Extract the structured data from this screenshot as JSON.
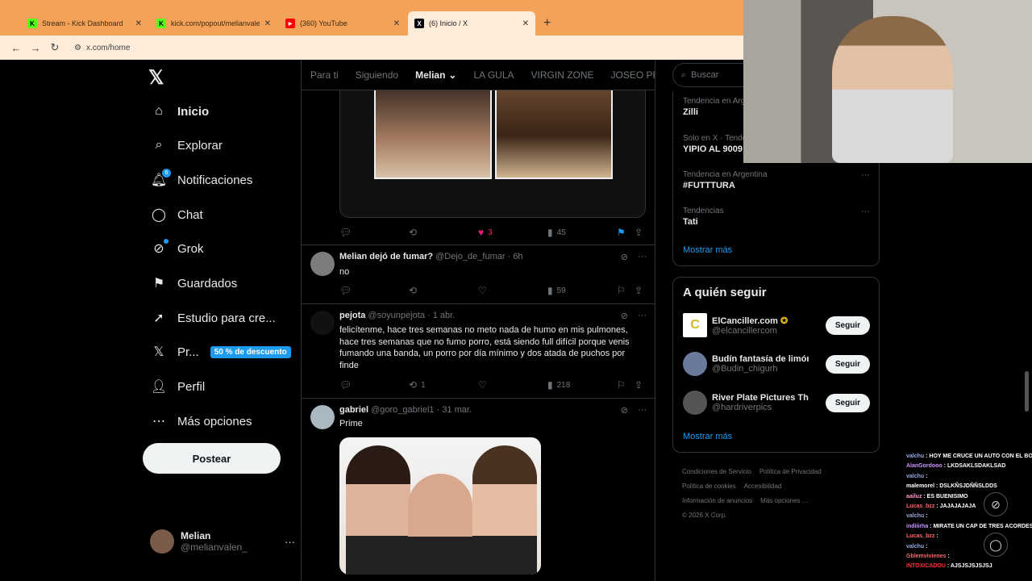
{
  "browser": {
    "tabs": [
      {
        "title": "Stream - Kick Dashboard",
        "favicon": "K",
        "color": "#53fc18"
      },
      {
        "title": "kick.com/popout/melianvalen/...",
        "favicon": "K",
        "color": "#53fc18"
      },
      {
        "title": "(360) YouTube",
        "favicon": "▶",
        "color": "#ff0000"
      },
      {
        "title": "(6) Inicio / X",
        "favicon": "X",
        "color": "#000000"
      }
    ],
    "url": "x.com/home"
  },
  "sidebar": {
    "items": [
      {
        "label": "Inicio",
        "icon": "home-icon"
      },
      {
        "label": "Explorar",
        "icon": "search-icon"
      },
      {
        "label": "Notificaciones",
        "icon": "bell-icon",
        "badge": "6"
      },
      {
        "label": "Chat",
        "icon": "chat-icon"
      },
      {
        "label": "Grok",
        "icon": "grok-icon"
      },
      {
        "label": "Guardados",
        "icon": "bookmark-icon"
      },
      {
        "label": "Estudio para cre...",
        "icon": "rocket-icon"
      },
      {
        "label": "Pr...",
        "icon": "x-icon",
        "promo": "50 % de descuento"
      },
      {
        "label": "Perfil",
        "icon": "person-icon"
      },
      {
        "label": "Más opciones",
        "icon": "more-circle-icon"
      }
    ],
    "post_label": "Postear",
    "account": {
      "name": "Melian",
      "handle": "@melianvalen_"
    }
  },
  "feed": {
    "tabs": [
      "Para ti",
      "Siguiendo",
      "Melian",
      "LA GULA",
      "VIRGIN ZONE",
      "JOSEO PRI"
    ],
    "active_tab": "Melian",
    "posts": [
      {
        "replies": "",
        "reposts": "",
        "likes": "3",
        "views": "45",
        "liked": true,
        "bookmarked": true
      },
      {
        "name": "Melian dejó de fumar?",
        "handle": "@Dejo_de_fumar",
        "time": "6h",
        "text": "no",
        "replies": "",
        "reposts": "",
        "likes": "",
        "views": "59"
      },
      {
        "name": "pejota",
        "handle": "@soyunpejota",
        "time": "1 abr.",
        "text": "felicítenme, hace tres semanas no meto nada de humo en mis pulmones, hace tres semanas que no fumo porro, está siendo full difícil porque venis fumando una banda, un porro por día mínimo y dos atada de puchos por finde",
        "replies": "",
        "reposts": "1",
        "likes": "",
        "views": "218"
      },
      {
        "name": "gabriel",
        "handle": "@goro_gabriel1",
        "time": "31 mar.",
        "text": "Prime"
      }
    ]
  },
  "right": {
    "search_placeholder": "Buscar",
    "trends": [
      {
        "context": "Tendencia en Argentina",
        "name": "Zilli"
      },
      {
        "context": "Solo en X · Tendencia",
        "name": "YIPIO AL 9009"
      },
      {
        "context": "Tendencia en Argentina",
        "name": "#FUTTTURA"
      },
      {
        "context": "Tendencias",
        "name": "Tati"
      }
    ],
    "trends_show_more": "Mostrar más",
    "who_to_follow_title": "A quién seguir",
    "follow_suggestions": [
      {
        "name": "ElCanciller.com",
        "handle": "@elcancillercom",
        "button": "Seguir"
      },
      {
        "name": "Budín fantasía de limón",
        "handle": "@Budin_chigurh",
        "button": "Seguir"
      },
      {
        "name": "River Plate Pictures Th...",
        "handle": "@hardriverpics",
        "button": "Seguir"
      }
    ],
    "follow_show_more": "Mostrar más",
    "footer": [
      "Condiciones de Servicio",
      "Política de Privacidad",
      "Política de cookies",
      "Accesibilidad",
      "Información de anuncios",
      "Más opciones ...",
      "© 2026 X Corp."
    ]
  },
  "stream_chat": [
    {
      "user": "valchu",
      "msg": "HOY ME CRUCE UN AUTO CON EL BOEBOE",
      "color": "#9ad"
    },
    {
      "user": "AlanGordooo",
      "msg": "LKDSAKLSDAKLSAD",
      "color": "#c9f"
    },
    {
      "user": "valchu",
      "msg": "",
      "color": "#9ad"
    },
    {
      "user": "malemorel",
      "msg": "DSLKÑSJDÑÑSLDDS",
      "color": "#fff"
    },
    {
      "user": "aailuz",
      "msg": "ES BUENISIMO",
      "color": "#f9c"
    },
    {
      "user": "Lucas_bzz",
      "msg": "JAJAJAJAJA",
      "color": "#f66"
    },
    {
      "user": "valchu",
      "msg": "",
      "color": "#9ad"
    },
    {
      "user": "indiiirha",
      "msg": "MIRATE UN CAP DE TRES ACORDES",
      "color": "#c9f"
    },
    {
      "user": "Lucas_bzz",
      "msg": "",
      "color": "#f66"
    },
    {
      "user": "valchu",
      "msg": "",
      "color": "#9ad"
    },
    {
      "user": "Gblemvivienes",
      "msg": "",
      "color": "#f66"
    },
    {
      "user": "INTOXICADOU",
      "msg": "AJSJSJSJSJSJ",
      "color": "#f33"
    }
  ]
}
